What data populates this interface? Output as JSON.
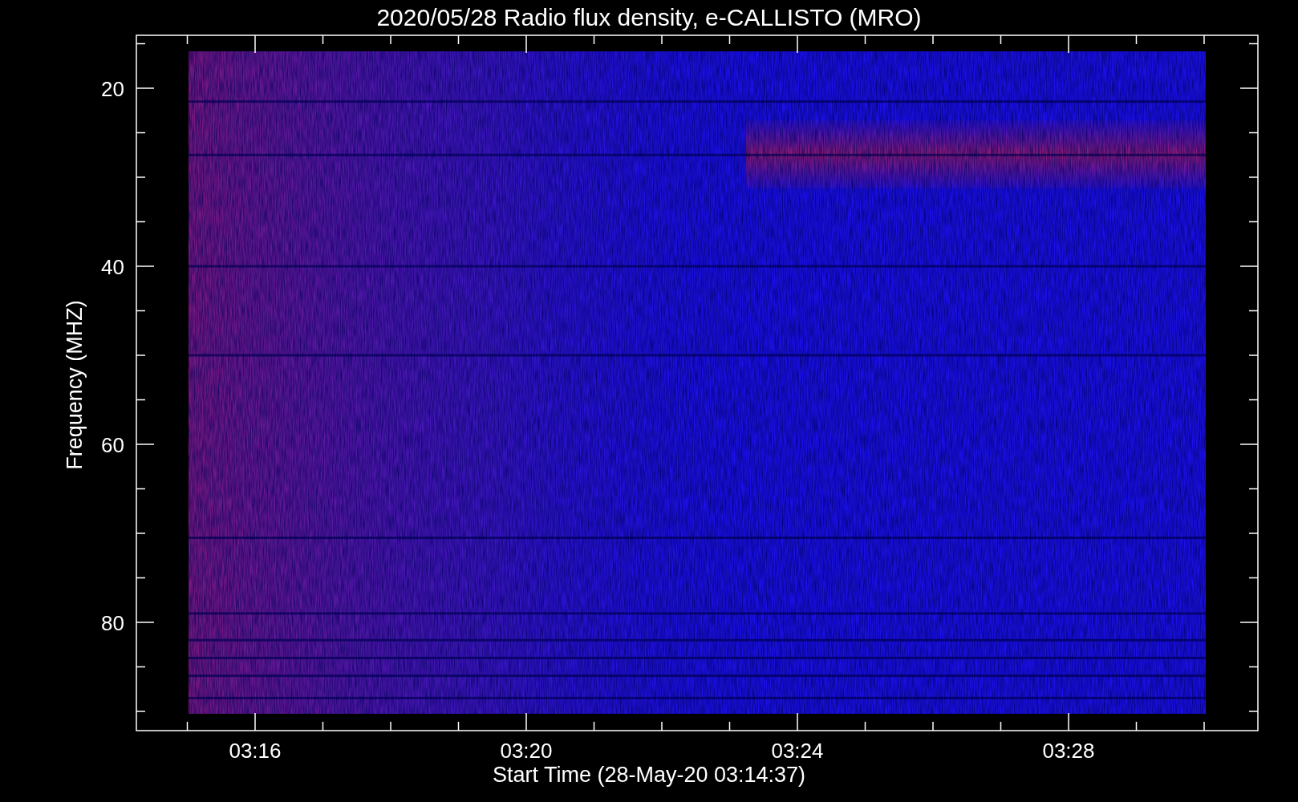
{
  "title": "2020/05/28  Radio flux density, e-CALLISTO (MRO)",
  "y_axis": {
    "label": "Frequency (MHZ)",
    "ticks": [
      "20",
      "40",
      "60",
      "80"
    ]
  },
  "x_axis": {
    "label": "Start Time (28-May-20 03:14:37)",
    "ticks": [
      "03:16",
      "03:20",
      "03:24",
      "03:28"
    ]
  }
}
